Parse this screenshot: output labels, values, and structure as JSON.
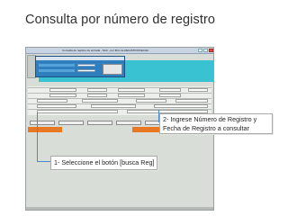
{
  "slide": {
    "title": "Consulta por número de registro"
  },
  "screen": {
    "window_title": "Consulta de registro de entrada - SAC - por filtro de REGISTRO/FECHA",
    "dialog_title": "Buscar Registro",
    "button_busca_reg": "Busca Reg"
  },
  "callouts": {
    "step1": "1- Seleccione el botón [busca Reg]",
    "step2_line1": "2- Ingrese Número de Registro y",
    "step2_line2": "Fecha de Registro a consultar"
  },
  "colors": {
    "dialog_blue": "#2f7fbf",
    "strip_cyan": "#39c2d2",
    "highlight_orange": "#e87824",
    "arrow_blue": "#4a88c8"
  }
}
